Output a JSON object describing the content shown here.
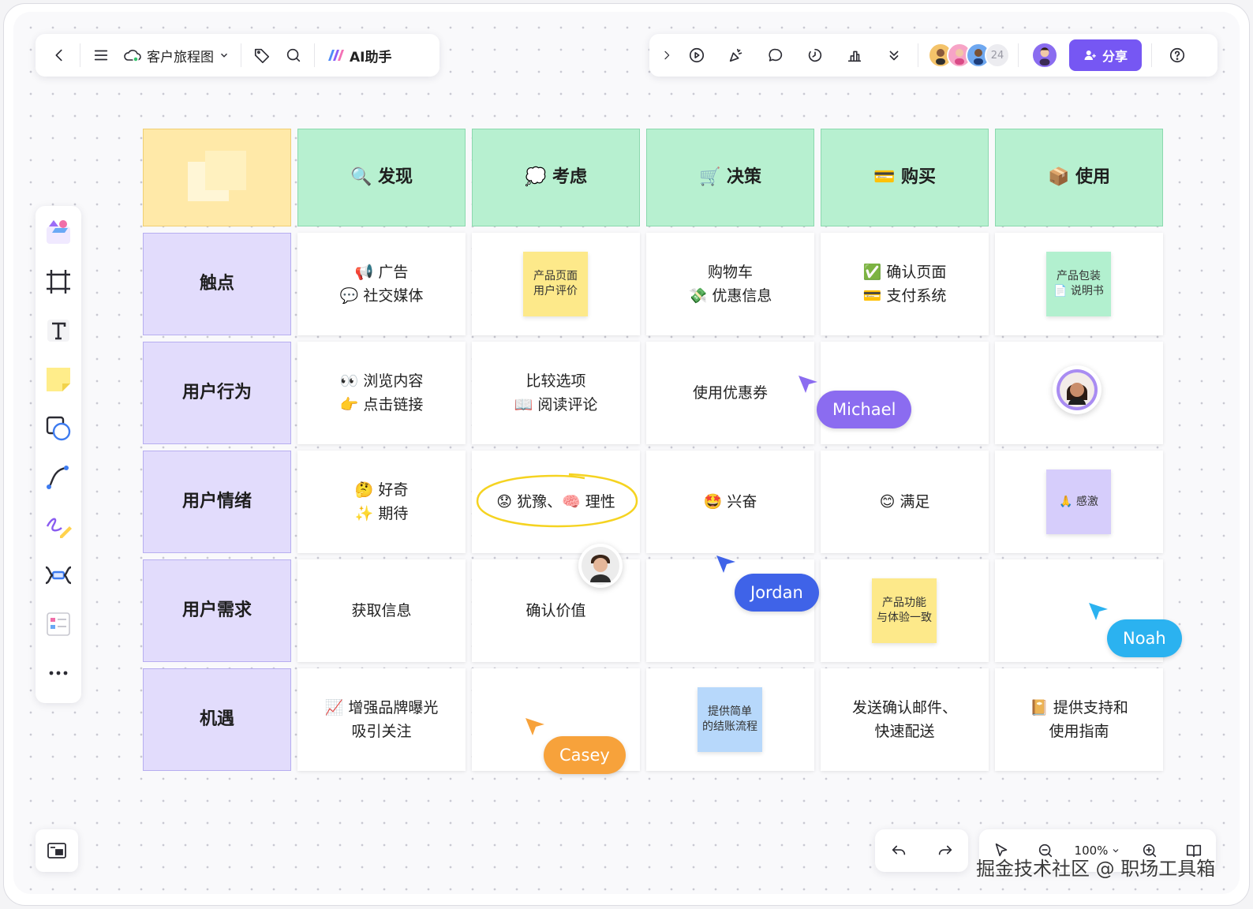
{
  "toolbar": {
    "doc_title": "客户旅程图",
    "ai_label": "AI助手",
    "avatar_count": "24",
    "share_label": "分享"
  },
  "columns": [
    {
      "icon": "🔍",
      "label": "发现"
    },
    {
      "icon": "💭",
      "label": "考虑"
    },
    {
      "icon": "🛒",
      "label": "决策"
    },
    {
      "icon": "💳",
      "label": "购买"
    },
    {
      "icon": "📦",
      "label": "使用"
    }
  ],
  "rows": [
    "触点",
    "用户行为",
    "用户情绪",
    "用户需求",
    "机遇"
  ],
  "cells": {
    "touch_discover": [
      "📢 广告",
      "💬 社交媒体"
    ],
    "touch_consider_sticky": [
      "产品页面",
      "用户评价"
    ],
    "touch_decide": [
      "购物车",
      "💸 优惠信息"
    ],
    "touch_buy": [
      "✅ 确认页面",
      "💳 支付系统"
    ],
    "touch_use_sticky": [
      "产品包装",
      "📄 说明书"
    ],
    "behavior_discover": [
      "👀 浏览内容",
      "👉 点击链接"
    ],
    "behavior_consider": [
      "比较选项",
      "📖 阅读评论"
    ],
    "behavior_decide": [
      "使用优惠券"
    ],
    "emotion_discover": [
      "🤔 好奇",
      "✨ 期待"
    ],
    "emotion_consider": [
      "😟 犹豫、🧠 理性"
    ],
    "emotion_decide": [
      "🤩 兴奋"
    ],
    "emotion_buy": [
      "😊 满足"
    ],
    "emotion_use_sticky": [
      "🙏 感激"
    ],
    "need_discover": [
      "获取信息"
    ],
    "need_consider": [
      "确认价值"
    ],
    "need_buy_sticky": [
      "产品功能",
      "与体验一致"
    ],
    "opp_discover": [
      "📈 增强品牌曝光",
      "吸引关注"
    ],
    "opp_decide_sticky": [
      "提供简单",
      "的结账流程"
    ],
    "opp_buy": [
      "发送确认邮件、",
      "快速配送"
    ],
    "opp_use": [
      "📔 提供支持和",
      "使用指南"
    ]
  },
  "cursors": [
    {
      "name": "Michael",
      "color": "#8b6cf0"
    },
    {
      "name": "Jordan",
      "color": "#3f63e8"
    },
    {
      "name": "Noah",
      "color": "#2bb2f0"
    },
    {
      "name": "Casey",
      "color": "#f7a23b"
    }
  ],
  "zoom": {
    "level": "100%"
  },
  "watermark": "掘金技术社区 @ 职场工具箱",
  "colors": {
    "header_green": "#b7f0d0",
    "row_purple": "#e2dcfc",
    "corner_yellow": "#ffe9a8",
    "share": "#7657f3"
  }
}
